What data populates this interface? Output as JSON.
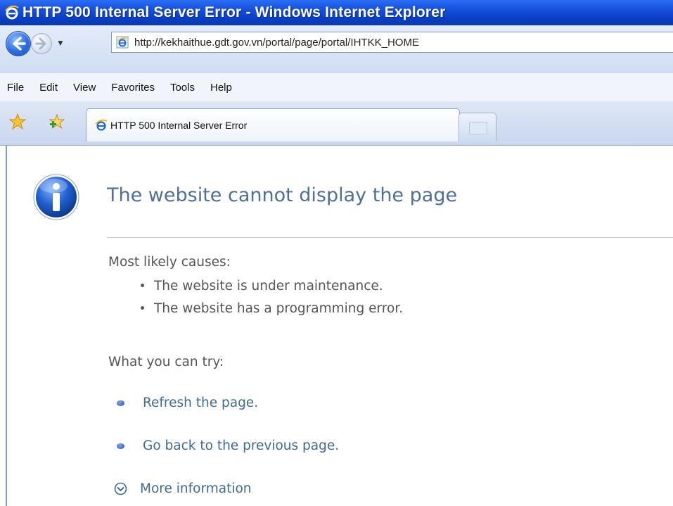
{
  "window": {
    "title": "HTTP 500 Internal Server Error - Windows Internet Explorer"
  },
  "address_bar": {
    "url": "http://kekhaithue.gdt.gov.vn/portal/page/portal/IHTKK_HOME"
  },
  "menu": {
    "items": [
      "File",
      "Edit",
      "View",
      "Favorites",
      "Tools",
      "Help"
    ]
  },
  "tabs": {
    "active_tab_label": "HTTP 500 Internal Server Error"
  },
  "error_page": {
    "heading": "The website cannot display the page",
    "causes_title": "Most likely causes:",
    "causes": [
      "The website is under maintenance.",
      "The website has a programming error."
    ],
    "try_title": "What you can try:",
    "actions": [
      "Refresh the page.",
      "Go back to the previous page."
    ],
    "more_info": "More information"
  },
  "colors": {
    "titlebar": "#0a3fc8",
    "heading": "#4e6f96",
    "link": "#3f6a94",
    "body_text": "#555555"
  }
}
